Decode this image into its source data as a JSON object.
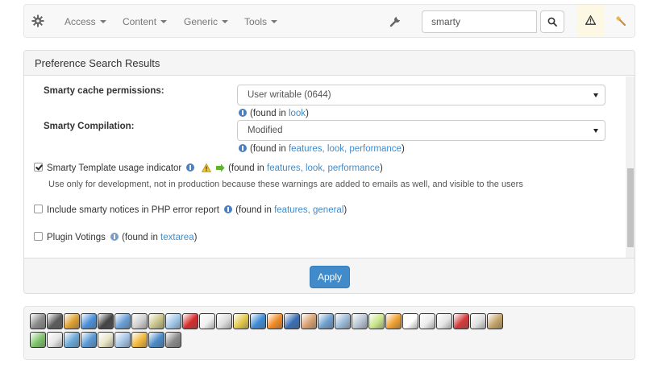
{
  "navbar": {
    "menus": [
      {
        "label": "Access"
      },
      {
        "label": "Content"
      },
      {
        "label": "Generic"
      },
      {
        "label": "Tools"
      }
    ],
    "search": {
      "value": "smarty",
      "placeholder": ""
    }
  },
  "panel": {
    "title": "Preference Search Results",
    "cache": {
      "label": "Smarty cache permissions:",
      "value": "User writable (0644)",
      "found_prefix": "(found in ",
      "links": [
        "look"
      ],
      "found_suffix": ")"
    },
    "compilation": {
      "label": "Smarty Compilation:",
      "value": "Modified",
      "found_prefix": "(found in ",
      "links_text": "features, look, performance",
      "found_suffix": ")"
    },
    "template_indicator": {
      "checked": true,
      "label": "Smarty Template usage indicator",
      "found_prefix": "(found in ",
      "links_text": "features, look, performance",
      "found_suffix": ")",
      "description": "Use only for development, not in production because these warnings are added to emails as well, and visible to the users"
    },
    "php_notices": {
      "checked": false,
      "label": "Include smarty notices in PHP error report",
      "found_prefix": "(found in ",
      "links_text": "features, general",
      "found_suffix": ")"
    },
    "plugin_votings": {
      "checked": false,
      "label": "Plugin Votings",
      "found_prefix": "(found in ",
      "links_text": "textarea",
      "found_suffix": ")"
    },
    "apply_label": "Apply"
  },
  "colors": {
    "primary": "#428bca",
    "warning_bg": "#fcf8e3",
    "link": "#428bca"
  },
  "toolbar": {
    "row1_icons": [
      {
        "name": "tools-icon",
        "color": "#8a8a8a"
      },
      {
        "name": "power-icon",
        "color": "#5b5b5b"
      },
      {
        "name": "exit-icon",
        "color": "#e0a030"
      },
      {
        "name": "users-icon",
        "color": "#4a90d9"
      },
      {
        "name": "book-icon",
        "color": "#444444"
      },
      {
        "name": "image-icon",
        "color": "#6aa0d8"
      },
      {
        "name": "edit-icon",
        "color": "#d0d0d0"
      },
      {
        "name": "map-icon",
        "color": "#c9c38a"
      },
      {
        "name": "photo-icon",
        "color": "#a0c8e8"
      },
      {
        "name": "flag-de-icon",
        "color": "#d62b2b"
      },
      {
        "name": "document-icon",
        "color": "#f0f0f0"
      },
      {
        "name": "clock-icon",
        "color": "#dcdcdc"
      },
      {
        "name": "key-icon",
        "color": "#e3c84a"
      },
      {
        "name": "chat-icon",
        "color": "#3d8bd6"
      },
      {
        "name": "rss-icon",
        "color": "#f08a24"
      },
      {
        "name": "globe-icon",
        "color": "#3a6fb5"
      },
      {
        "name": "group-icon",
        "color": "#d9a070"
      },
      {
        "name": "search-icon",
        "color": "#6f9fd0"
      },
      {
        "name": "calculator-icon",
        "color": "#9bb9d6"
      },
      {
        "name": "tags-icon",
        "color": "#b8c6d4"
      },
      {
        "name": "notepad-icon",
        "color": "#c9e68a"
      },
      {
        "name": "palette-icon",
        "color": "#f0a030"
      },
      {
        "name": "font-icon",
        "color": "#ffffff"
      },
      {
        "name": "text-icon",
        "color": "#ececec"
      },
      {
        "name": "book-open-icon",
        "color": "#e6e6e6"
      },
      {
        "name": "delete-icon",
        "color": "#d43a3a"
      },
      {
        "name": "calendar-icon",
        "color": "#e0e0e0"
      },
      {
        "name": "clipboard-icon",
        "color": "#c3a46a"
      }
    ],
    "row2_icons": [
      {
        "name": "window-icon",
        "color": "#7fc46a"
      },
      {
        "name": "mail-icon",
        "color": "#e6e6e6"
      },
      {
        "name": "share-icon",
        "color": "#6aa8d8"
      },
      {
        "name": "home-icon",
        "color": "#5a9ad6"
      },
      {
        "name": "screen-icon",
        "color": "#e9e6c8"
      },
      {
        "name": "tea-icon",
        "color": "#a6c6e6"
      },
      {
        "name": "dollar-icon",
        "color": "#f2b83a"
      },
      {
        "name": "refresh-globe-icon",
        "color": "#4a8ac6"
      },
      {
        "name": "keyboard-icon",
        "color": "#8a8a8a"
      }
    ]
  }
}
